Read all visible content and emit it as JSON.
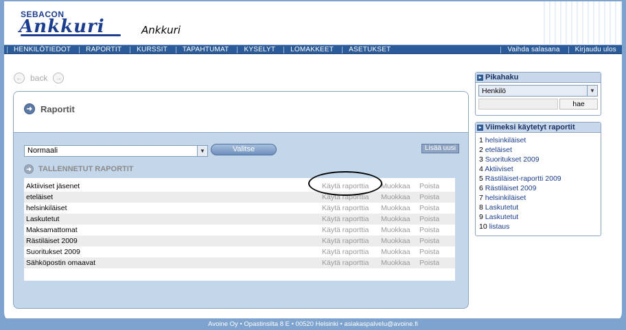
{
  "header": {
    "logo_top": "SEBACON",
    "logo_main": "Ankkuri",
    "app_name": "Ankkuri"
  },
  "nav": {
    "items": [
      "HENKILÖTIEDOT",
      "RAPORTIT",
      "KURSSIT",
      "TAPAHTUMAT",
      "KYSELYT",
      "LOMAKKEET",
      "ASETUKSET"
    ],
    "right": [
      "Vaihda salasana",
      "Kirjaudu ulos"
    ]
  },
  "back": {
    "label": "back"
  },
  "panel": {
    "title": "Raportit",
    "select_value": "Normaali",
    "valitse_label": "Valitse",
    "add_label": "Lisää uusi",
    "section_title": "TALLENNETUT RAPORTIT",
    "reports": [
      "Aktiiviset jäsenet",
      "eteläiset",
      "helsinkiläiset",
      "Laskutetut",
      "Maksamattomat",
      "Rästiläiset 2009",
      "Suoritukset 2009",
      "Sähköpostin omaavat"
    ],
    "action_use": "Käytä raporttia",
    "action_edit": "Muokkaa",
    "action_delete": "Poista"
  },
  "pikahaku": {
    "title": "Pikahaku",
    "select_value": "Henkilö",
    "search_value": "",
    "button_label": "hae"
  },
  "recent": {
    "title": "Viimeksi käytetyt raportit",
    "items": [
      {
        "n": "1",
        "label": "helsinkiläiset"
      },
      {
        "n": "2",
        "label": "eteläiset"
      },
      {
        "n": "3",
        "label": "Suoritukset 2009"
      },
      {
        "n": "4",
        "label": "Aktiiviset"
      },
      {
        "n": "5",
        "label": "Rästiläiset-raportti 2009"
      },
      {
        "n": "6",
        "label": "Rästiläiset 2009"
      },
      {
        "n": "7",
        "label": "helsinkiläiset"
      },
      {
        "n": "8",
        "label": "Laskutetut"
      },
      {
        "n": "9",
        "label": "Laskutetut"
      },
      {
        "n": "10",
        "label": "listaus"
      }
    ]
  },
  "footer": {
    "text": "Avoine Oy • Opastinsilta 8 E • 00520 Helsinki • asiakaspalvelu@avoine.fi"
  },
  "colors": {
    "brand": "#1a3d8f",
    "nav": "#2b5b98",
    "panel": "#c4d6ea",
    "frame": "#7fa3cf"
  }
}
